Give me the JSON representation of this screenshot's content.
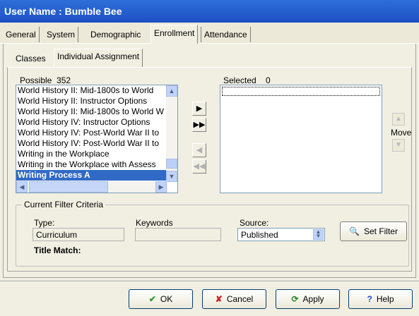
{
  "window": {
    "title": "User Name : Bumble Bee"
  },
  "tabs": [
    {
      "label": "General"
    },
    {
      "label": "System"
    },
    {
      "label": "Demographic"
    },
    {
      "label": "Enrollment"
    },
    {
      "label": "Attendance"
    }
  ],
  "subtabs": [
    {
      "label": "Classes"
    },
    {
      "label": "Individual Assignment"
    }
  ],
  "possible": {
    "label": "Possible",
    "count": "352",
    "items": [
      "World History II:  Mid-1800s to World",
      "World History II: Instructor Options",
      "World History II: Mid-1800s to World W",
      "World History IV: Instructor Options",
      "World History IV: Post-World War II to",
      "World History IV: Post-World War II to",
      "Writing in the Workplace",
      "Writing in the Workplace with Assess",
      "Writing Process A"
    ]
  },
  "selected": {
    "label": "Selected",
    "count": "0"
  },
  "move": {
    "label": "Move"
  },
  "filter": {
    "title": "Current Filter Criteria",
    "type_label": "Type:",
    "type_value": "Curriculum",
    "keywords_label": "Keywords",
    "keywords_value": "",
    "source_label": "Source:",
    "source_value": "Published",
    "title_match_label": "Title Match:",
    "set_filter_label": "Set Filter"
  },
  "buttons": {
    "ok": "OK",
    "cancel": "Cancel",
    "apply": "Apply",
    "help": "Help"
  },
  "colors": {
    "titlebar": "#1d50c4",
    "selection": "#316ac5"
  }
}
